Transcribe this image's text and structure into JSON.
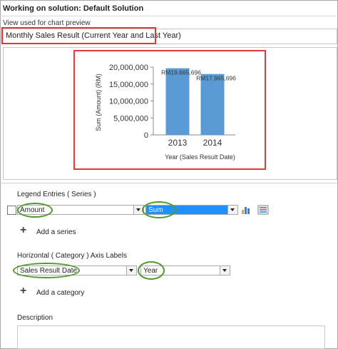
{
  "header": {
    "title": "Working on solution: Default Solution",
    "view_label": "View used for chart preview",
    "view_value": "Monthly Sales Result (Current Year and Last Year)"
  },
  "chart_data": {
    "type": "bar",
    "categories": [
      "2013",
      "2014"
    ],
    "values": [
      19665696,
      17965696
    ],
    "data_labels": [
      "RM19,665,696",
      "RM17,965,696"
    ],
    "ylabel": "Sum (Amount) (RM)",
    "xlabel": "Year (Sales Result Date)",
    "ylim": [
      0,
      20000000
    ],
    "yticks": [
      "20,000,000",
      "15,000,000",
      "10,000,000",
      "5,000,000",
      "0"
    ],
    "ytick_values": [
      20000000,
      15000000,
      10000000,
      5000000,
      0
    ],
    "bar_color": "#5b9bd5"
  },
  "series_section": {
    "label": "Legend Entries ( Series )",
    "field": "Amount",
    "aggregate": "Sum",
    "add_label": "Add a series"
  },
  "category_section": {
    "label": "Horizontal ( Category ) Axis Labels",
    "field": "Sales Result Date",
    "grouping": "Year",
    "add_label": "Add a category"
  },
  "description": {
    "label": "Description"
  },
  "colors": {
    "highlight_red": "#e0393a",
    "highlight_green": "#4e9a2a",
    "selected_blue": "#1e90ff"
  }
}
